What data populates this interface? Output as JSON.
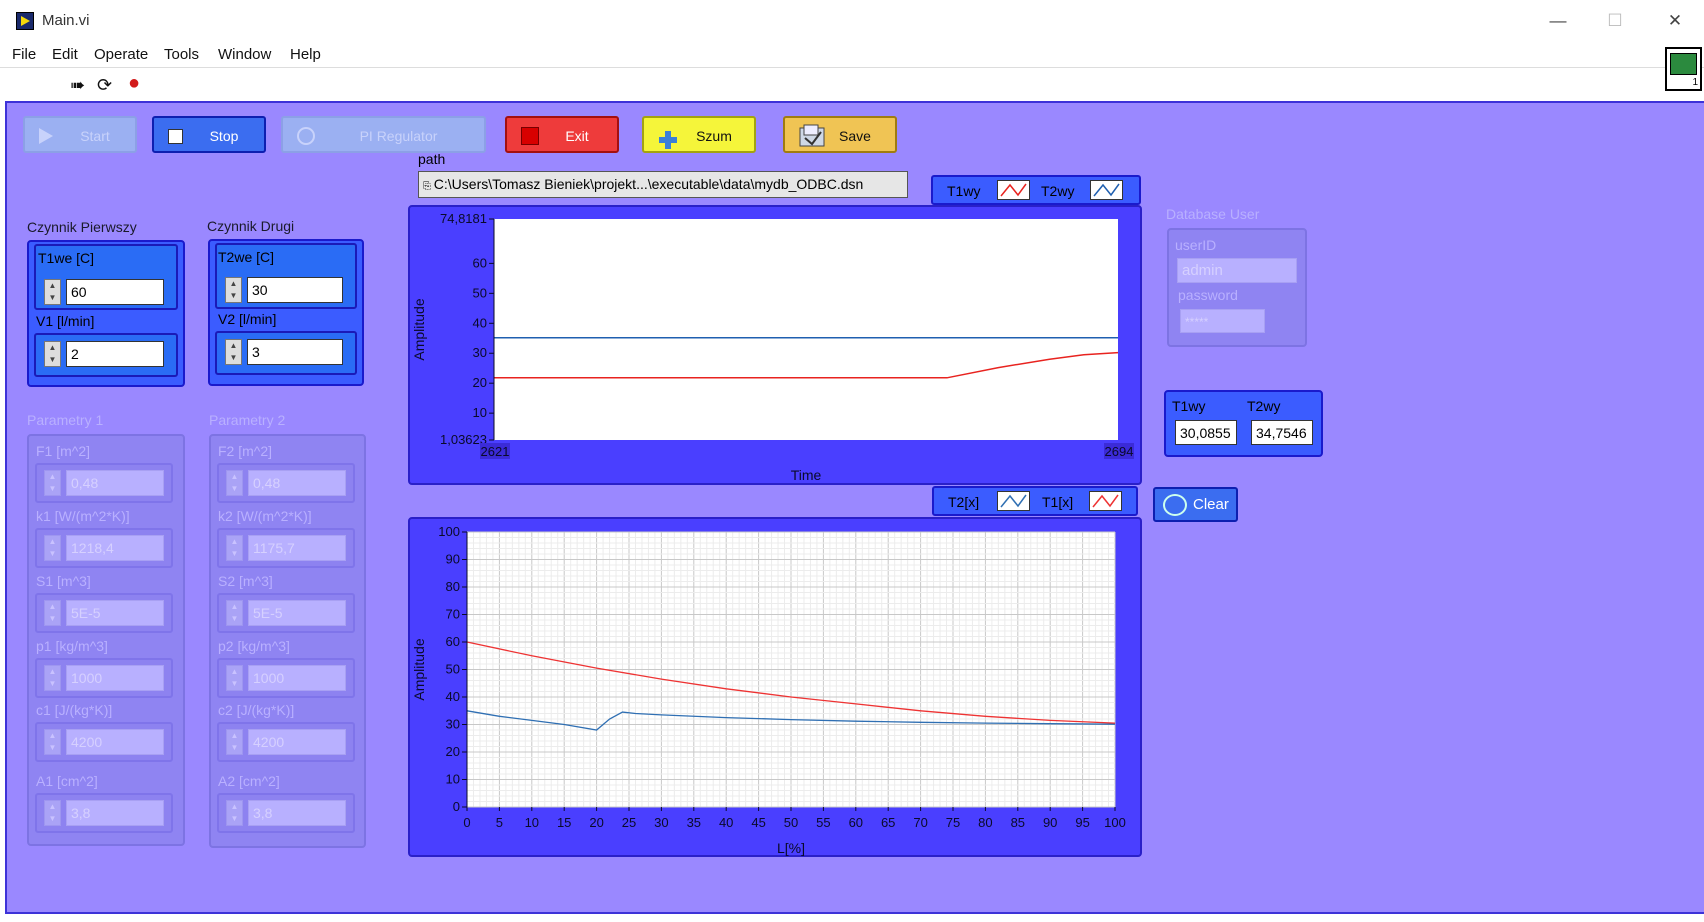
{
  "window": {
    "title": "Main.vi",
    "minimize": "—",
    "maximize": "☐",
    "close": "✕"
  },
  "menu": [
    "File",
    "Edit",
    "Operate",
    "Tools",
    "Window",
    "Help"
  ],
  "toolbar": {
    "run": "➠",
    "run_cont": "⟳",
    "abort": "●"
  },
  "corner_icon_number": "1",
  "buttons": {
    "start": "Start",
    "stop": "Stop",
    "pi": "PI Regulator",
    "exit": "Exit",
    "szum": "Szum",
    "save": "Save",
    "clear": "Clear"
  },
  "path": {
    "label": "path",
    "value": "C:\\Users\\Tomasz Bieniek\\projekt...\\executable\\data\\mydb_ODBC.dsn"
  },
  "czynnik1": {
    "title": "Czynnik Pierwszy",
    "t_label": "T1we [C]",
    "t_value": "60",
    "v_label": "V1 [l/min]",
    "v_value": "2"
  },
  "czynnik2": {
    "title": "Czynnik Drugi",
    "t_label": "T2we [C]",
    "t_value": "30",
    "v_label": "V2 [l/min]",
    "v_value": "3"
  },
  "param1": {
    "title": "Parametry 1",
    "items": [
      {
        "label": "F1 [m^2]",
        "value": "0,48"
      },
      {
        "label": "k1 [W/(m^2*K)]",
        "value": "1218,4"
      },
      {
        "label": "S1 [m^3]",
        "value": "5E-5"
      },
      {
        "label": "p1 [kg/m^3]",
        "value": "1000"
      },
      {
        "label": "c1 [J/(kg*K)]",
        "value": "4200"
      },
      {
        "label": "A1 [cm^2]",
        "value": "3,8"
      }
    ]
  },
  "param2": {
    "title": "Parametry 2",
    "items": [
      {
        "label": "F2 [m^2]",
        "value": "0,48"
      },
      {
        "label": "k2 [W/(m^2*K)]",
        "value": "1175,7"
      },
      {
        "label": "S2 [m^3]",
        "value": "5E-5"
      },
      {
        "label": "p2 [kg/m^3]",
        "value": "1000"
      },
      {
        "label": "c2 [J/(kg*K)]",
        "value": "4200"
      },
      {
        "label": "A2 [cm^2]",
        "value": "3,8"
      }
    ]
  },
  "db": {
    "title": "Database User",
    "user_label": "userID",
    "user_value": "admin",
    "pass_label": "password",
    "pass_value": "*****"
  },
  "outputs": {
    "t1_label": "T1wy",
    "t1_value": "30,0855",
    "t2_label": "T2wy",
    "t2_value": "34,7546"
  },
  "chart_data": [
    {
      "type": "line",
      "ylabel": "Amplitude",
      "xlabel": "Time",
      "xlim": [
        2621,
        2694
      ],
      "x_tick_labels": [
        "2621",
        "2694"
      ],
      "ylim": [
        1.03623,
        74.8181
      ],
      "y_tick_labels": [
        "74,8181",
        "60",
        "50",
        "40",
        "30",
        "20",
        "10",
        "1,03623"
      ],
      "legend": [
        "T1wy",
        "T2wy"
      ],
      "series": [
        {
          "name": "T1wy",
          "color": "#e8231f",
          "x": [
            2621,
            2640,
            2660,
            2674,
            2680,
            2686,
            2690,
            2694
          ],
          "values": [
            21.8,
            21.8,
            21.8,
            21.8,
            25.2,
            28,
            29.5,
            30.2
          ]
        },
        {
          "name": "T2wy",
          "color": "#1f5fb0",
          "x": [
            2621,
            2694
          ],
          "values": [
            35.2,
            35.2
          ]
        }
      ]
    },
    {
      "type": "line",
      "ylabel": "Amplitude",
      "xlabel": "L[%]",
      "xlim": [
        0,
        100
      ],
      "x_tick_labels": [
        "0",
        "5",
        "10",
        "15",
        "20",
        "25",
        "30",
        "35",
        "40",
        "45",
        "50",
        "55",
        "60",
        "65",
        "70",
        "75",
        "80",
        "85",
        "90",
        "95",
        "100"
      ],
      "ylim": [
        0,
        100
      ],
      "y_tick_labels": [
        "100",
        "90",
        "80",
        "70",
        "60",
        "50",
        "40",
        "30",
        "20",
        "10",
        "0"
      ],
      "grid": true,
      "legend": [
        "T2[x]",
        "T1[x]"
      ],
      "series": [
        {
          "name": "T2[x]",
          "color": "#2f6fb3",
          "x": [
            0,
            5,
            10,
            15,
            20,
            22,
            24,
            26,
            30,
            40,
            50,
            60,
            70,
            80,
            90,
            100
          ],
          "values": [
            35,
            33,
            31.5,
            30,
            28,
            32,
            34.5,
            34,
            33.5,
            32.5,
            31.8,
            31.2,
            30.8,
            30.5,
            30.3,
            30.1
          ]
        },
        {
          "name": "T1[x]",
          "color": "#ee3333",
          "x": [
            0,
            10,
            20,
            30,
            40,
            50,
            60,
            70,
            80,
            90,
            100
          ],
          "values": [
            60,
            55,
            50.5,
            46.5,
            43,
            40,
            37.5,
            35,
            33,
            31.5,
            30.5
          ]
        }
      ]
    }
  ]
}
